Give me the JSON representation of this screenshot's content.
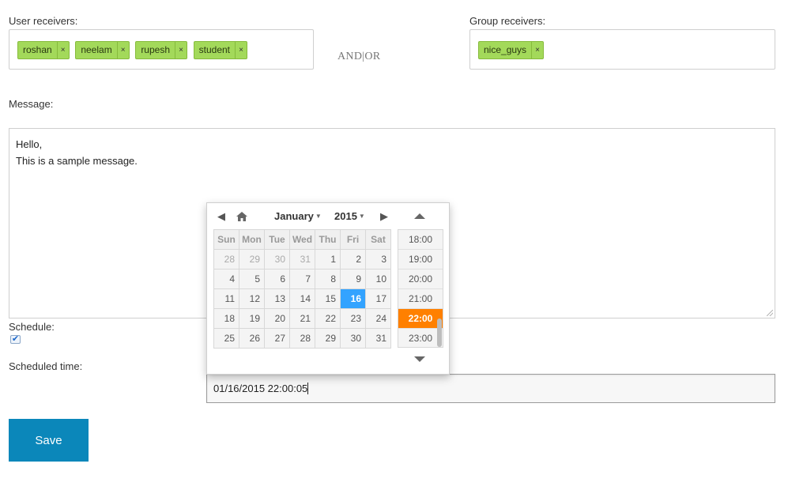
{
  "user_receivers": {
    "label": "User receivers:",
    "tags": [
      "roshan",
      "neelam",
      "rupesh",
      "student"
    ],
    "remove_glyph": "×"
  },
  "andor_text": "AND|OR",
  "group_receivers": {
    "label": "Group receivers:",
    "tags": [
      "nice_guys"
    ],
    "remove_glyph": "×"
  },
  "message": {
    "label": "Message:",
    "line1": "Hello,",
    "line2": "This is a sample message."
  },
  "schedule": {
    "label": "Schedule:",
    "checked": true,
    "check_glyph": "✔"
  },
  "scheduled_time": {
    "label": "Scheduled time:",
    "value": "01/16/2015 22:00:05"
  },
  "save_label": "Save",
  "picker": {
    "month": "January",
    "year": "2015",
    "prev_icon": "◀",
    "home_icon": "home-icon",
    "next_icon": "▶",
    "weekdays": [
      "Sun",
      "Mon",
      "Tue",
      "Wed",
      "Thu",
      "Fri",
      "Sat"
    ],
    "weeks": [
      [
        "28",
        "29",
        "30",
        "31",
        "1",
        "2",
        "3"
      ],
      [
        "4",
        "5",
        "6",
        "7",
        "8",
        "9",
        "10"
      ],
      [
        "11",
        "12",
        "13",
        "14",
        "15",
        "16",
        "17"
      ],
      [
        "18",
        "19",
        "20",
        "21",
        "22",
        "23",
        "24"
      ],
      [
        "25",
        "26",
        "27",
        "28",
        "29",
        "30",
        "31"
      ]
    ],
    "selected_day": "16",
    "times": [
      "18:00",
      "19:00",
      "20:00",
      "21:00",
      "22:00",
      "23:00"
    ],
    "selected_time": "22:00",
    "colors": {
      "selected_day": "#33a3ff",
      "selected_time": "#ff8000",
      "save": "#0b87ba",
      "tag": "#a3d95a"
    }
  }
}
